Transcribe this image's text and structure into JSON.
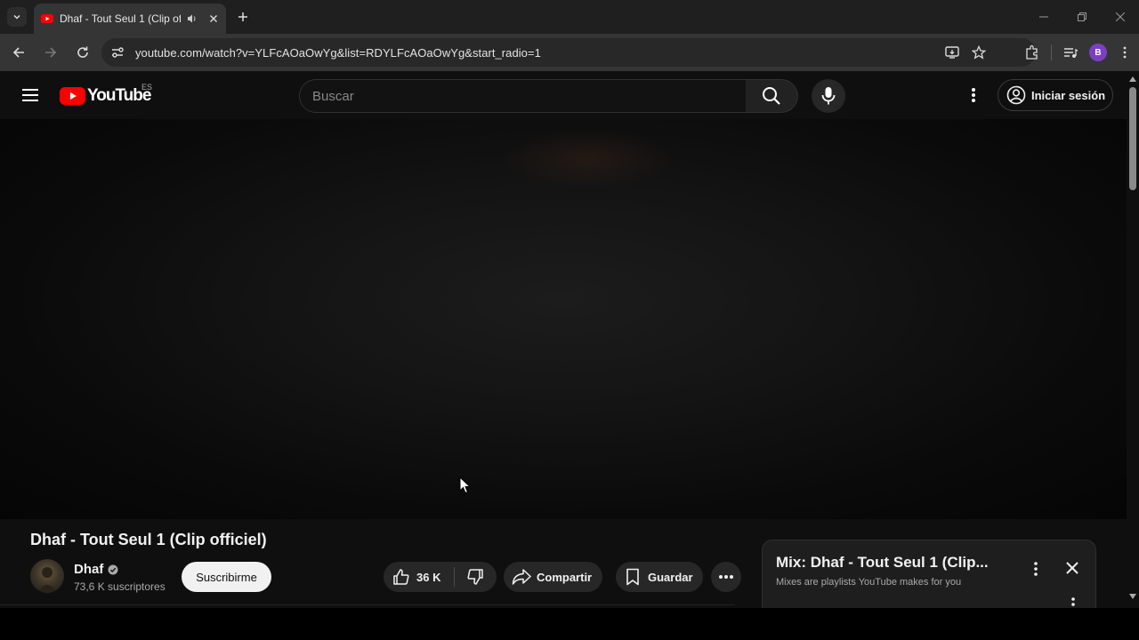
{
  "browser": {
    "tab_title": "Dhaf - Tout Seul 1 (Clip officiel)",
    "url": "youtube.com/watch?v=YLFcAOaOwYg&list=RDYLFcAOaOwYg&start_radio=1",
    "profile_initial": "B"
  },
  "header": {
    "logo_text": "YouTube",
    "country_code": "ES",
    "search_placeholder": "Buscar",
    "signin_label": "Iniciar sesión"
  },
  "video": {
    "title": "Dhaf - Tout Seul 1 (Clip officiel)",
    "channel_name": "Dhaf",
    "subscribers": "73,6 K suscriptores",
    "subscribe_label": "Suscribirme",
    "likes": "36 K",
    "share_label": "Compartir",
    "save_label": "Guardar"
  },
  "mix": {
    "title": "Mix: Dhaf - Tout Seul 1 (Clip...",
    "subtitle": "Mixes are playlists YouTube makes for you"
  },
  "colors": {
    "brand_red": "#ff0000",
    "background": "#0f0f0f",
    "profile": "#7b3fc4"
  }
}
